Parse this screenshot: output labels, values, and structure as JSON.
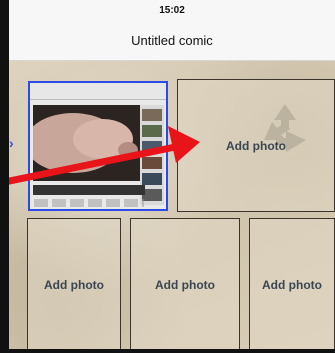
{
  "status_bar": {
    "time": "15:02"
  },
  "nav_bar": {
    "title": "Untitled comic"
  },
  "panels": [
    {
      "label": "Add photo"
    },
    {
      "label": "Add photo"
    },
    {
      "label": "Add photo"
    },
    {
      "label": "Add photo"
    }
  ],
  "colors": {
    "selection_border": "#2c4ae6",
    "arrow": "#e8141a",
    "panel_label": "#3b4652"
  },
  "icons": {
    "arrow": "red-arrow-annotation-icon",
    "recycle": "recycle-watermark-icon"
  }
}
